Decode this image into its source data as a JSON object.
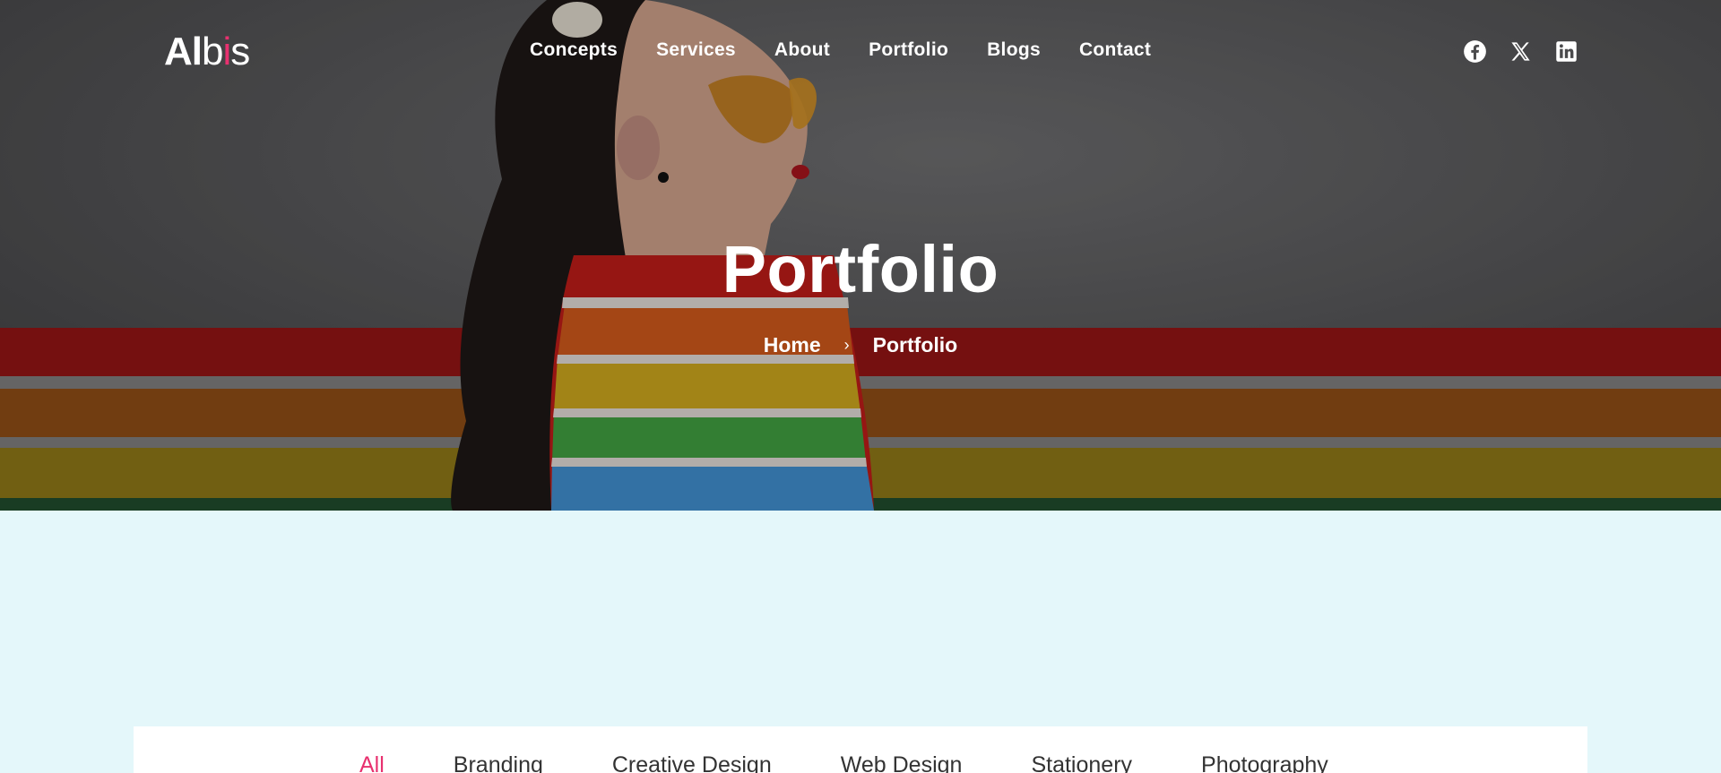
{
  "brand": {
    "logo_part1": "Al",
    "logo_part2": "b",
    "logo_dot": "i",
    "logo_part3": "s",
    "accent_color": "#e8316f"
  },
  "nav": {
    "items": [
      {
        "label": "Concepts"
      },
      {
        "label": "Services"
      },
      {
        "label": "About"
      },
      {
        "label": "Portfolio"
      },
      {
        "label": "Blogs"
      },
      {
        "label": "Contact"
      }
    ]
  },
  "social": {
    "icons": [
      "facebook-icon",
      "x-twitter-icon",
      "linkedin-icon"
    ]
  },
  "hero": {
    "title": "Portfolio",
    "breadcrumb": {
      "home": "Home",
      "separator": "›",
      "current": "Portfolio"
    }
  },
  "filters": {
    "active_color": "#e8316f",
    "items": [
      {
        "label": "All",
        "active": true
      },
      {
        "label": "Branding",
        "active": false
      },
      {
        "label": "Creative Design",
        "active": false
      },
      {
        "label": "Web Design",
        "active": false
      },
      {
        "label": "Stationery",
        "active": false
      },
      {
        "label": "Photography",
        "active": false
      }
    ]
  },
  "colors": {
    "page_background": "#e4f7fa",
    "panel_background": "#ffffff"
  }
}
